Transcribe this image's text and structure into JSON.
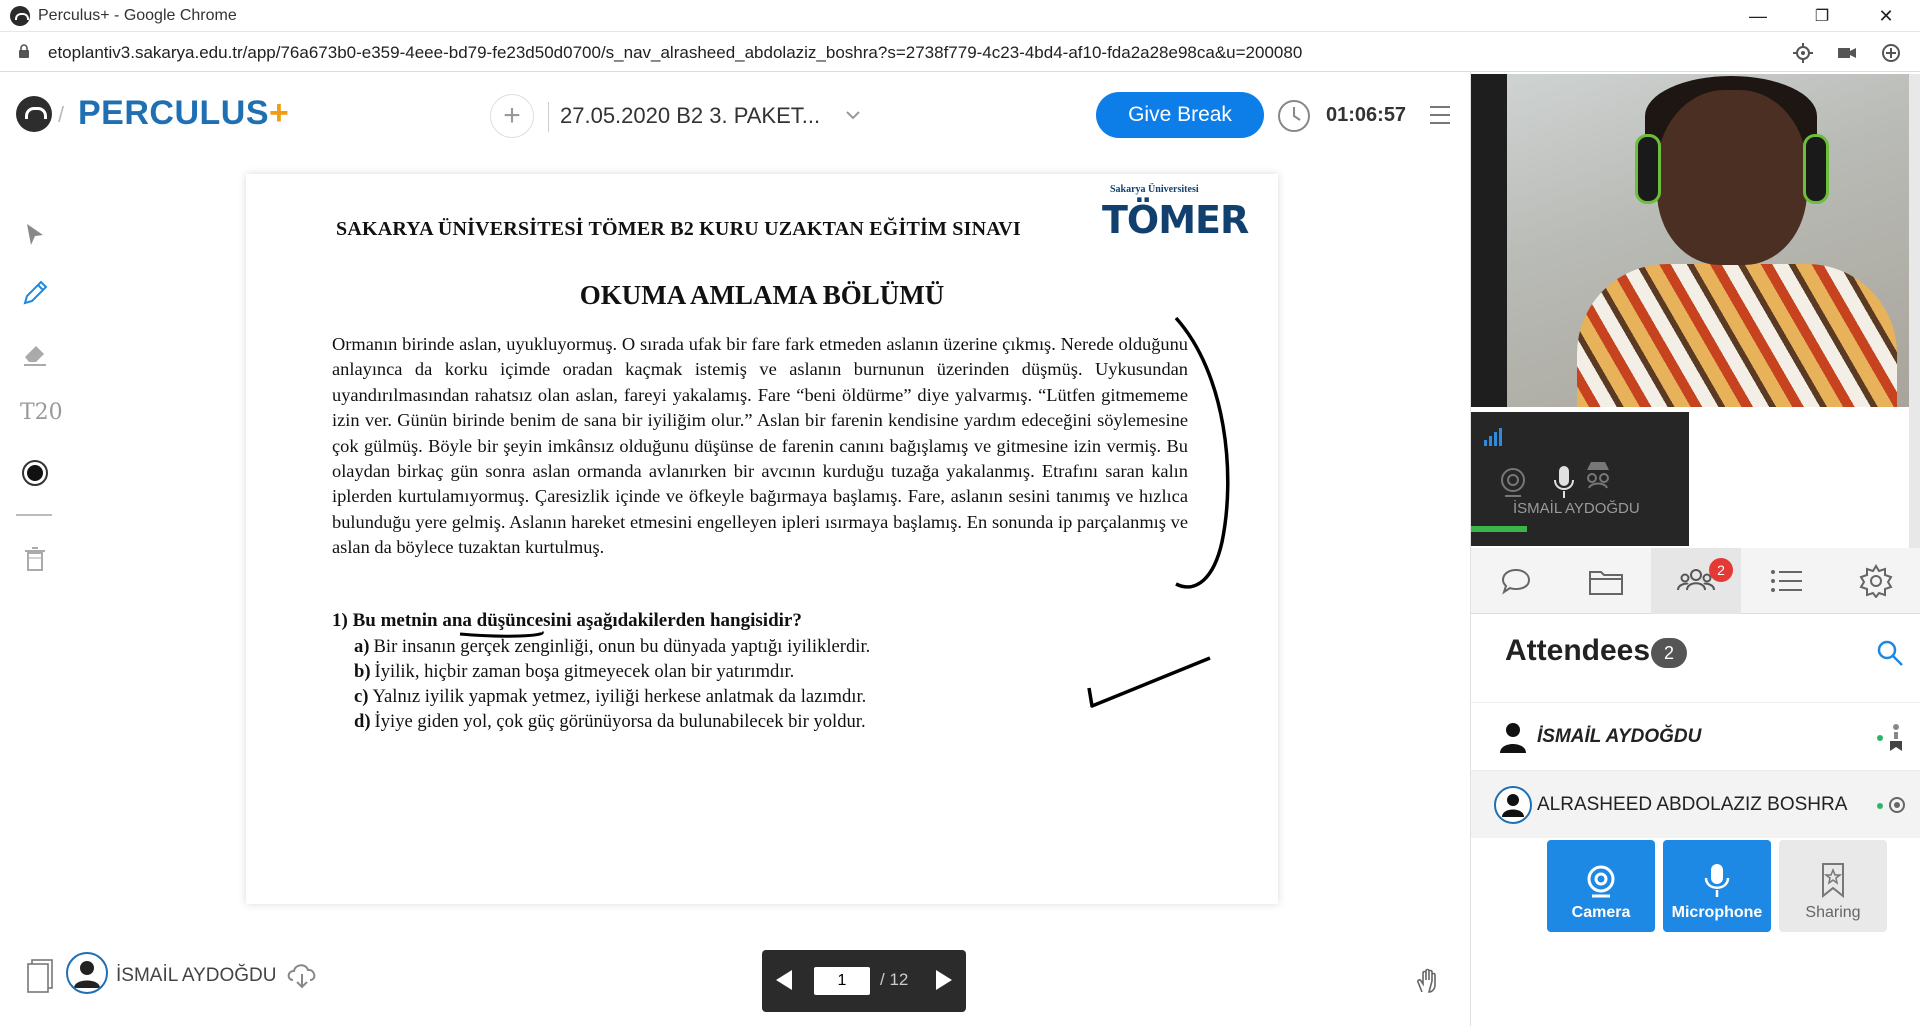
{
  "browser": {
    "window_title": "Perculus+ - Google Chrome",
    "url": "etoplantiv3.sakarya.edu.tr/app/76a673b0-e359-4eee-bd79-fe23d50d0700/s_nav_alrasheed_abdolaziz_boshra?s=2738f779-4c23-4bd4-af10-fda2a28e98ca&u=200080",
    "minimize_label": "—",
    "restore_label": "❐",
    "close_label": "✕"
  },
  "header": {
    "logo_text": "PERCULUS",
    "logo_plus": "+",
    "slash": "/",
    "add_label": "+",
    "session_title": "27.05.2020 B2 3. PAKET...",
    "give_break": "Give Break",
    "timer": "01:06:57"
  },
  "toolbar": {
    "text_tool_label": "T20"
  },
  "document": {
    "header": "SAKARYA ÜNİVERSİTESİ TÖMER B2 KURU UZAKTAN EĞİTİM SINAVI",
    "logo_small": "Sakarya Üniversitesi",
    "logo_big": "TÖMER",
    "section_title": "OKUMA AMLAMA BÖLÜMÜ",
    "passage": "Ormanın birinde aslan, uyukluyormuş. O sırada ufak bir fare fark etmeden aslanın üzerine çıkmış. Nerede olduğunu anlayınca da korku içimde oradan kaçmak istemiş ve aslanın burnunun üzerinden düşmüş. Uykusundan uyandırılmasından rahatsız olan aslan, fareyi yakalamış. Fare “beni öldürme” diye yalvarmış. “Lütfen gitmememe izin ver. Günün birinde benim de sana bir iyiliğim olur.” Aslan bir farenin kendisine yardım edeceğini söylemesine çok gülmüş. Böyle bir şeyin imkânsız olduğunu düşünse de farenin canını bağışlamış ve gitmesine izin vermiş. Bu olaydan birkaç gün sonra aslan ormanda avlanırken bir avcının kurduğu tuzağa yakalanmış. Etrafını saran kalın iplerden kurtulamıyormuş. Çaresizlik içinde ve öfkeyle bağırmaya başlamış. Fare, aslanın sesini tanımış ve hızlıca bulunduğu yere gelmiş. Aslanın hareket etmesini engelleyen ipleri ısırmaya başlamış. En sonunda ip parçalanmış ve aslan da böylece tuzaktan kurtulmuş.",
    "question": "1) Bu metnin ana düşüncesini aşağıdakilerden hangisidir?",
    "options": [
      {
        "letter": "a)",
        "text": "Bir insanın gerçek zenginliği, onun bu dünyada yaptığı iyiliklerdir."
      },
      {
        "letter": "b)",
        "text": "İyilik, hiçbir zaman boşa gitmeyecek olan bir yatırımdır."
      },
      {
        "letter": "c)",
        "text": "Yalnız iyilik yapmak yetmez, iyiliği herkese anlatmak da lazımdır."
      },
      {
        "letter": "d)",
        "text": "İyiye giden yol, çok güç görünüyorsa da bulunabilecek bir yoldur."
      }
    ]
  },
  "bottom": {
    "user_name": "İSMAİL AYDOĞDU",
    "page_current": "1",
    "page_total": "/ 12"
  },
  "video": {
    "tile_name": "İSMAİL AYDOĞDU"
  },
  "panel": {
    "attendees_title": "Attendees",
    "attendees_count": "2",
    "attendees_badge": "2",
    "attendees": [
      {
        "name": "İSMAİL AYDOĞDU"
      },
      {
        "name": "ALRASHEED ABDOLAZIZ BOSHRA"
      }
    ],
    "buttons": {
      "camera": "Camera",
      "microphone": "Microphone",
      "sharing": "Sharing"
    }
  },
  "colors": {
    "accent": "#0d7de8",
    "brand_blue": "#1f6fb2",
    "brand_orange": "#f39c12",
    "badge_red": "#e53935",
    "online_green": "#2fb36b"
  }
}
